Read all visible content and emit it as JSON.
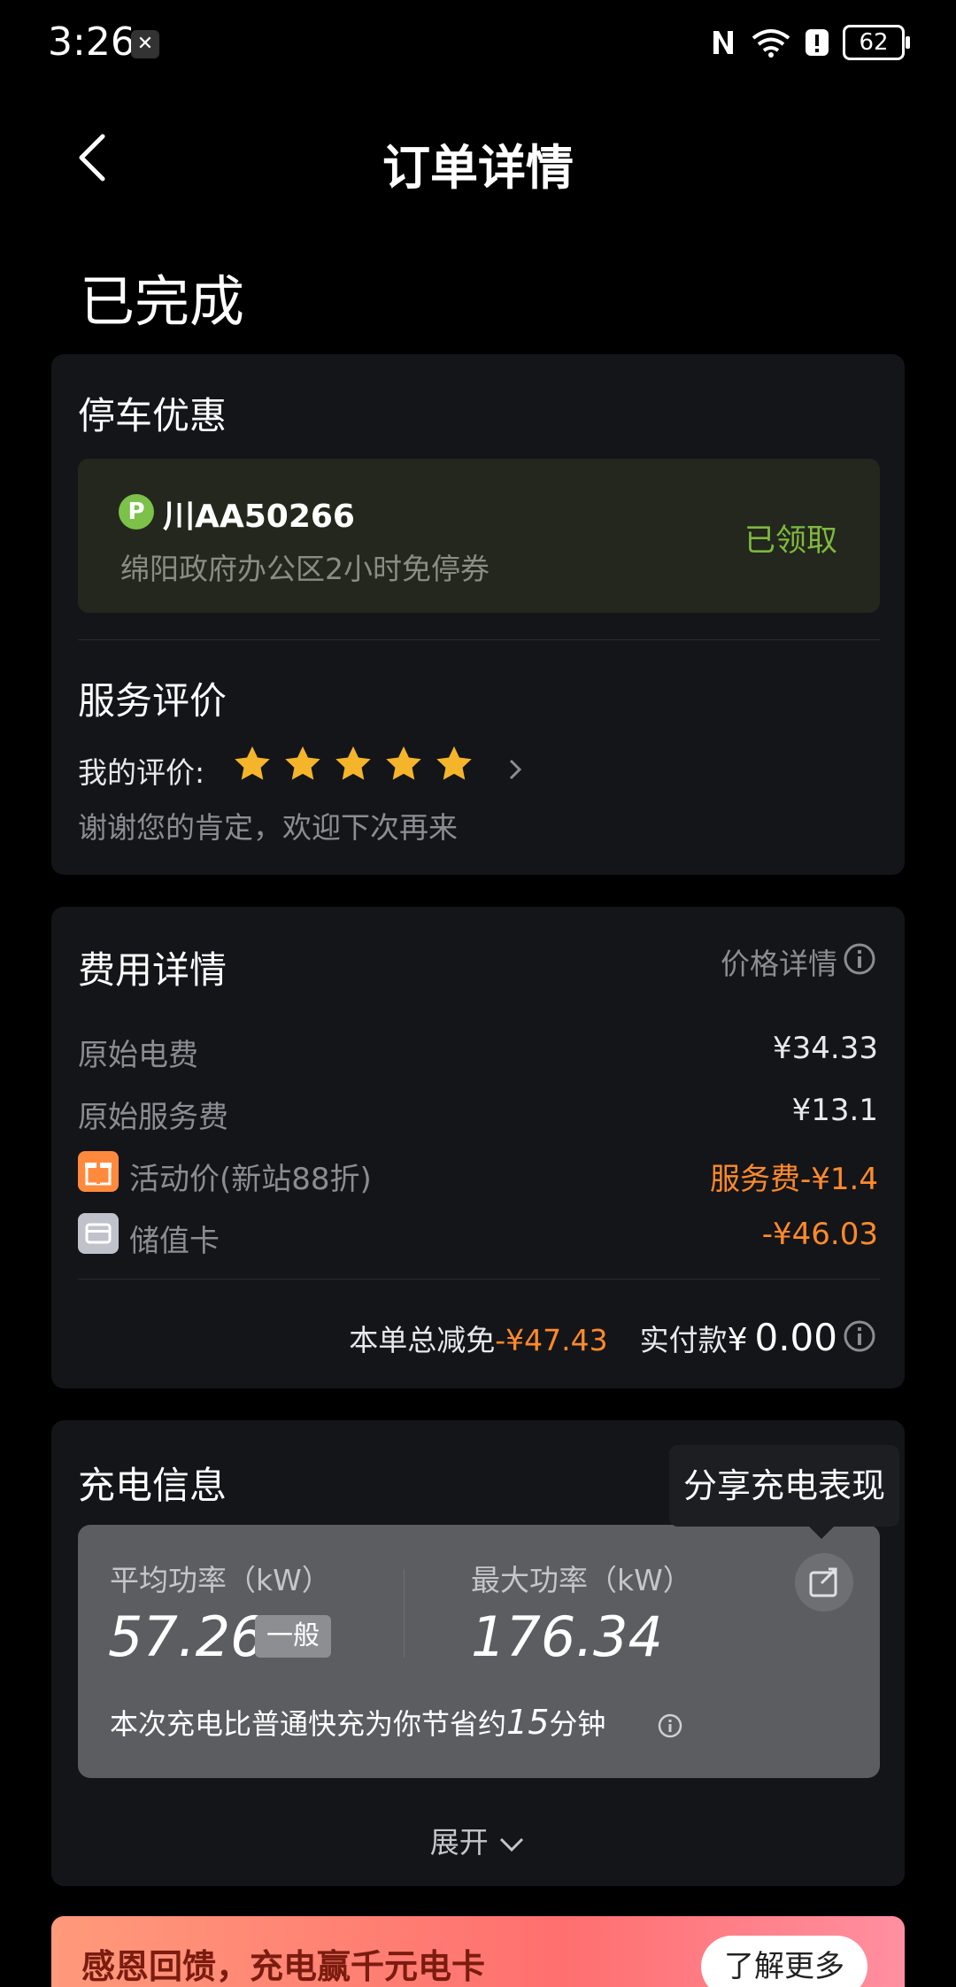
{
  "status_bar": {
    "time": "3:26",
    "notify_glyph": "✕",
    "battery": "62"
  },
  "header": {
    "title": "订单详情"
  },
  "order": {
    "status": "已完成"
  },
  "parking": {
    "title": "停车优惠",
    "badge": "P",
    "plate": "川AA50266",
    "description": "绵阳政府办公区2小时免停券",
    "state": "已领取"
  },
  "review": {
    "title": "服务评价",
    "my_rating_label": "我的评价:",
    "rating": 5,
    "rating_max": 5,
    "message": "谢谢您的肯定，欢迎下次再来"
  },
  "fees": {
    "title": "费用详情",
    "price_detail_link": "价格详情",
    "rows": [
      {
        "label": "原始电费",
        "value": "¥34.33"
      },
      {
        "label": "原始服务费",
        "value": "¥13.1"
      },
      {
        "label": "活动价(新站88折)",
        "value": "服务费-¥1.4",
        "icon": "gift-icon"
      },
      {
        "label": "储值卡",
        "value": "-¥46.03",
        "icon": "card-icon"
      }
    ],
    "total_discount_label": "本单总减免",
    "total_discount_value": "-¥47.43",
    "paid_label": "实付款",
    "paid_currency": "¥",
    "paid_amount": "0.00"
  },
  "charging": {
    "title": "充电信息",
    "share_tooltip": "分享充电表现",
    "avg_power_label": "平均功率（kW）",
    "avg_power_value": "57.26",
    "avg_level": "一般",
    "max_power_label": "最大功率（kW）",
    "max_power_value": "176.34",
    "saving_text_prefix": "本次充电比普通快充为你节省约",
    "saving_minutes": "15",
    "saving_text_suffix": "分钟",
    "expand_label": "展开"
  },
  "banner": {
    "text": "感恩回馈，充电赢千元电卡",
    "button": "了解更多"
  },
  "colors": {
    "accent_orange": "#ff8a2a",
    "accent_green": "#7fb83f",
    "star": "#f5b52a",
    "card_bg": "#141519"
  }
}
